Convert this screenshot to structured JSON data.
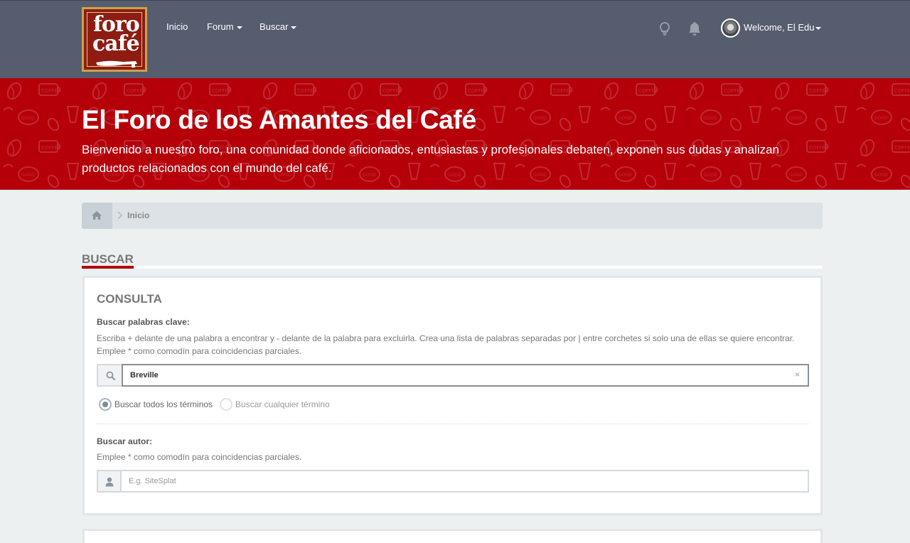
{
  "navbar": {
    "logo_text": [
      "foro",
      "café"
    ],
    "links": [
      {
        "label": "Inicio",
        "has_caret": false
      },
      {
        "label": "Forum",
        "has_caret": true
      },
      {
        "label": "Buscar",
        "has_caret": true
      }
    ],
    "icons": [
      "lightbulb-icon",
      "bell-icon"
    ],
    "user": {
      "welcome": "Welcome, El Edu"
    }
  },
  "banner": {
    "title": "El Foro de los Amantes del Café",
    "subtitle": "Bienvenido a nuestro foro, una comunidad donde aficionados, entusiastas y profesionales debaten, exponen sus dudas y analizan productos relacionados con el mundo del café.",
    "color": "#b5000a"
  },
  "breadcrumb": {
    "home_icon": "home-icon",
    "items": [
      "Inicio"
    ]
  },
  "section": {
    "title": "BUSCAR",
    "accent_color": "#b5000a"
  },
  "consulta": {
    "title": "CONSULTA",
    "keywords_label": "Buscar palabras clave:",
    "keywords_hint": "Escriba + delante de una palabra a encontrar y - delante de la palabra para excluirla. Crea una lista de palabras separadas por | entre corchetes si solo una de ellas se quiere encontrar. Emplee * como comodín para coincidencias parciales.",
    "keywords_value": "Breville",
    "clear_symbol": "×",
    "radio_all": "Buscar todos los términos",
    "radio_any": "Buscar cualquier término",
    "radio_selected": "all",
    "author_label": "Buscar autor:",
    "author_hint": "Emplee * como comodín para coincidencias parciales.",
    "author_placeholder": "E.g. SiteSplat",
    "author_value": ""
  }
}
